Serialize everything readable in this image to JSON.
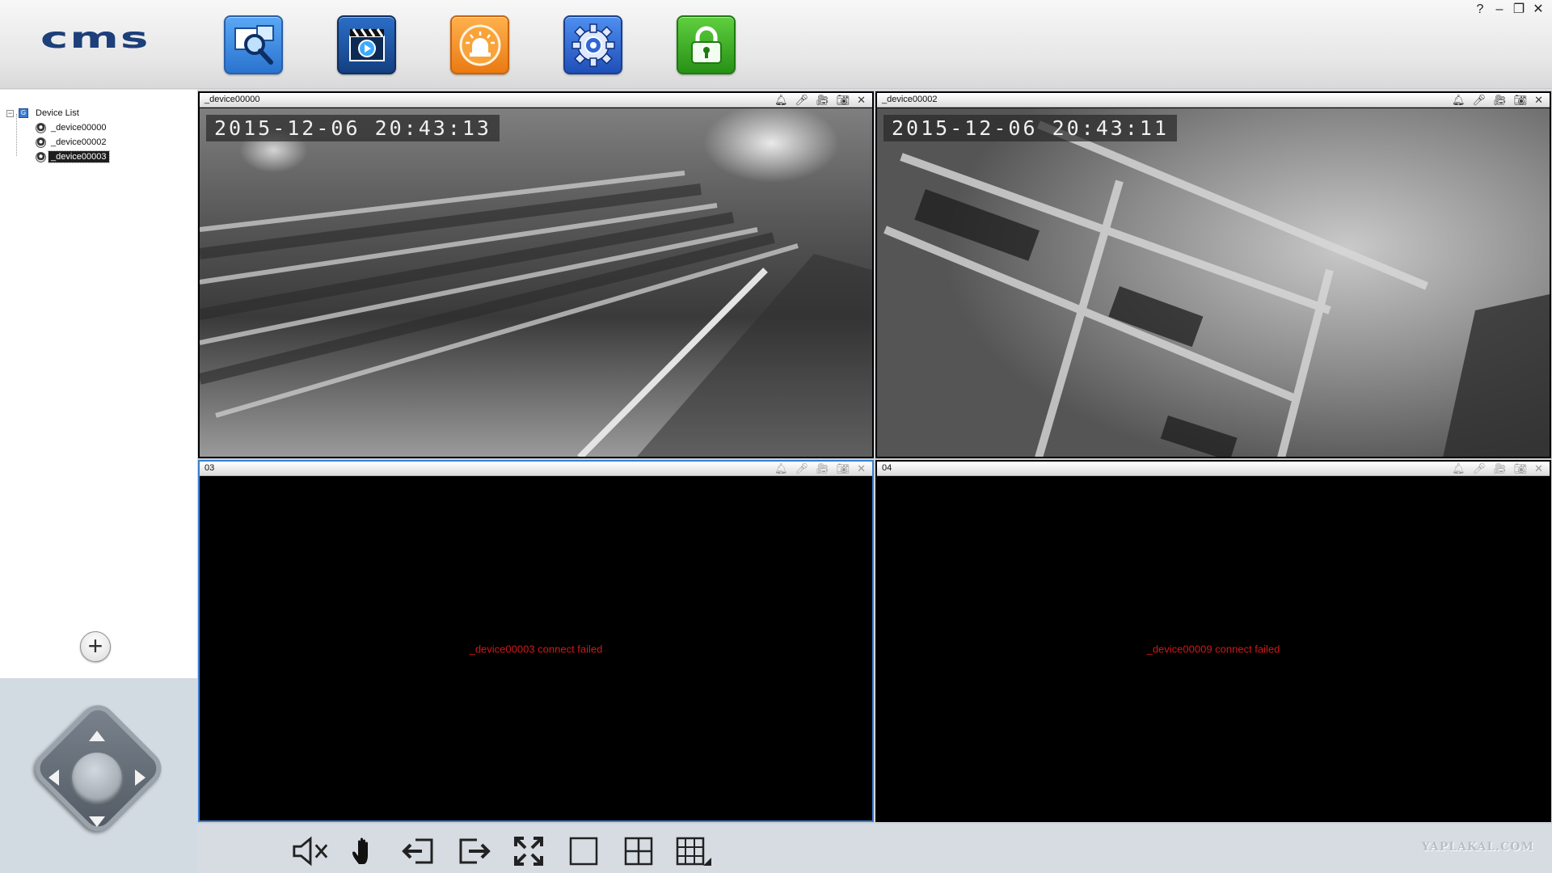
{
  "app": {
    "logo_text": "cms",
    "window_controls": [
      "?",
      "–",
      "❐",
      "✕"
    ]
  },
  "toolbar": {
    "buttons": [
      {
        "name": "device-search",
        "icon": "search-icon",
        "color": "#3d8ce6"
      },
      {
        "name": "playback",
        "icon": "video-clapper-icon",
        "color": "#1a5aa8"
      },
      {
        "name": "alarm",
        "icon": "alarm-light-icon",
        "color": "#f39220"
      },
      {
        "name": "settings",
        "icon": "gear-icon",
        "color": "#2f68d6"
      },
      {
        "name": "lock",
        "icon": "lock-icon",
        "color": "#3fae2a"
      }
    ]
  },
  "device_tree": {
    "root_label": "Device List",
    "devices": [
      {
        "label": "_device00000",
        "selected": false
      },
      {
        "label": "_device00002",
        "selected": false
      },
      {
        "label": "_device00003",
        "selected": true
      }
    ]
  },
  "panels": [
    {
      "title": "_device00000",
      "osd": "2015-12-06   20:43:13",
      "status": "",
      "active": false
    },
    {
      "title": "_device00002",
      "osd": "2015-12-06   20:43:11",
      "status": "",
      "active": false
    },
    {
      "title": "03",
      "osd": "",
      "status": "_device00003 connect failed",
      "active": true
    },
    {
      "title": "04",
      "osd": "",
      "status": "_device00009 connect failed",
      "active": false
    }
  ],
  "bottom_toolbar": [
    "mute-icon",
    "hand-icon",
    "previous-page-icon",
    "next-page-icon",
    "fullscreen-icon",
    "single-view-icon",
    "quad-view-icon",
    "multi-view-icon"
  ],
  "watermark": "YAPLAKAL.COM",
  "colors": {
    "error_text": "#d01818",
    "active_border": "#3a7ed0",
    "logo": "#1d3f7a"
  }
}
